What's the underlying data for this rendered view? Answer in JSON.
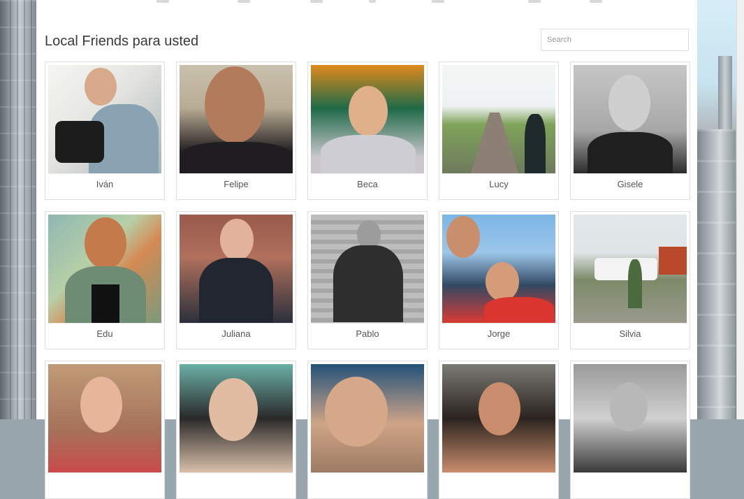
{
  "section": {
    "title": "Local Friends para usted"
  },
  "search": {
    "placeholder": "Search"
  },
  "friends": [
    {
      "name": "Iván"
    },
    {
      "name": "Felipe"
    },
    {
      "name": "Beca"
    },
    {
      "name": "Lucy"
    },
    {
      "name": "Gisele"
    },
    {
      "name": "Edu"
    },
    {
      "name": "Juliana"
    },
    {
      "name": "Pablo"
    },
    {
      "name": "Jorge"
    },
    {
      "name": "Silvia"
    },
    {
      "name": ""
    },
    {
      "name": ""
    },
    {
      "name": ""
    },
    {
      "name": ""
    },
    {
      "name": ""
    }
  ]
}
